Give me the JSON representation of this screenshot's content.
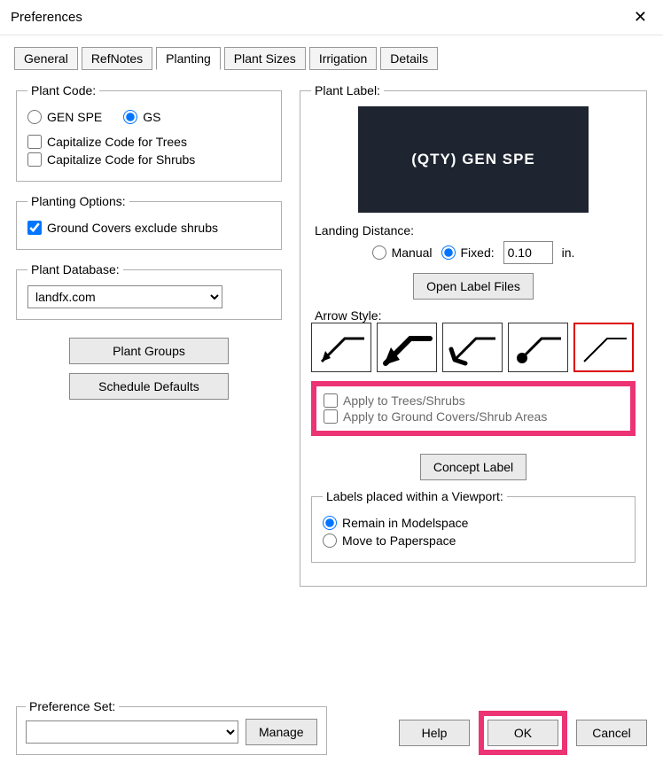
{
  "window": {
    "title": "Preferences",
    "close_glyph": "✕"
  },
  "tabs": {
    "general": "General",
    "refnotes": "RefNotes",
    "planting": "Planting",
    "plantsizes": "Plant Sizes",
    "irrigation": "Irrigation",
    "details": "Details"
  },
  "plant_code": {
    "legend": "Plant Code:",
    "opt_genspe": "GEN SPE",
    "opt_gs": "GS",
    "cap_trees": "Capitalize Code for Trees",
    "cap_shrubs": "Capitalize Code for Shrubs"
  },
  "planting_options": {
    "legend": "Planting Options:",
    "gc_exclude": "Ground Covers exclude shrubs"
  },
  "plant_database": {
    "legend": "Plant Database:",
    "selected": "landfx.com"
  },
  "left_buttons": {
    "plant_groups": "Plant Groups",
    "schedule_defaults": "Schedule Defaults"
  },
  "plant_label": {
    "legend": "Plant Label:",
    "preview_text": "(QTY) GEN SPE",
    "landing_legend": "Landing Distance:",
    "landing_manual": "Manual",
    "landing_fixed": "Fixed:",
    "landing_value": "0.10",
    "landing_unit": "in.",
    "open_label_files": "Open Label Files",
    "arrow_legend": "Arrow Style:",
    "apply_trees": "Apply to Trees/Shrubs",
    "apply_gc": "Apply to Ground Covers/Shrub Areas",
    "concept_label": "Concept Label",
    "viewport_legend": "Labels placed within a Viewport:",
    "remain_model": "Remain in Modelspace",
    "move_paper": "Move to Paperspace"
  },
  "footer": {
    "pref_set_legend": "Preference Set:",
    "manage": "Manage",
    "help": "Help",
    "ok": "OK",
    "cancel": "Cancel"
  }
}
